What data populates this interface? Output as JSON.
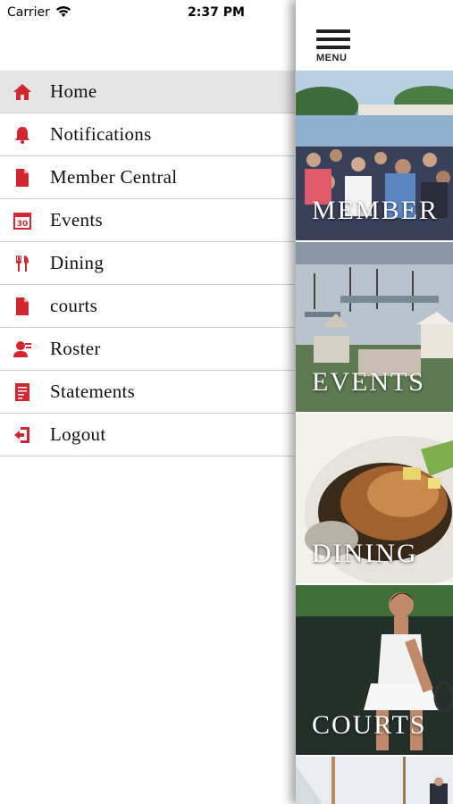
{
  "status_bar": {
    "carrier": "Carrier",
    "time": "2:37 PM",
    "battery_level": 1.0
  },
  "menu": {
    "items": [
      {
        "label": "Home",
        "icon": "home-icon",
        "active": true
      },
      {
        "label": "Notifications",
        "icon": "bell-icon"
      },
      {
        "label": "Member Central",
        "icon": "document-icon"
      },
      {
        "label": "Events",
        "icon": "calendar-icon"
      },
      {
        "label": "Dining",
        "icon": "utensils-icon"
      },
      {
        "label": "courts",
        "icon": "document-icon"
      },
      {
        "label": "Roster",
        "icon": "person-icon"
      },
      {
        "label": "Statements",
        "icon": "statement-icon"
      },
      {
        "label": "Logout",
        "icon": "logout-icon"
      }
    ],
    "accent_color": "#d22630"
  },
  "panel": {
    "menu_label": "MENU",
    "tiles": [
      {
        "caption": "MEMBER"
      },
      {
        "caption": "EVENTS"
      },
      {
        "caption": "DINING"
      },
      {
        "caption": "COURTS"
      },
      {
        "caption": ""
      }
    ]
  },
  "calendar_icon_text": "30"
}
